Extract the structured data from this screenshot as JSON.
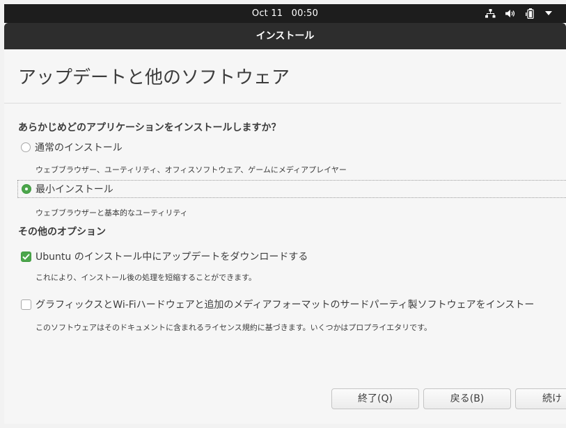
{
  "topbar": {
    "date": "Oct 11",
    "time": "00:50",
    "icons": [
      "network-icon",
      "volume-icon",
      "battery-icon",
      "chevron-down-icon"
    ]
  },
  "window": {
    "title": "インストール"
  },
  "page": {
    "title": "アップデートと他のソフトウェア"
  },
  "install_type": {
    "question": "あらかじめどのアプリケーションをインストールしますか？",
    "options": [
      {
        "label": "通常のインストール",
        "description": "ウェブブラウザー、ユーティリティ、オフィスソフトウェア、ゲームにメディアプレイヤー",
        "selected": false
      },
      {
        "label": "最小インストール",
        "description": "ウェブブラウザーと基本的なユーティリティ",
        "selected": true
      }
    ]
  },
  "other_options": {
    "heading": "その他のオプション",
    "items": [
      {
        "label": "Ubuntu のインストール中にアップデートをダウンロードする",
        "description": "これにより、インストール後の処理を短縮することができます。",
        "checked": true
      },
      {
        "label": "グラフィックスとWi-Fiハードウェアと追加のメディアフォーマットのサードパーティ製ソフトウェアをインストー",
        "description": "このソフトウェアはそのドキュメントに含まれるライセンス規約に基づきます。いくつかはプロプライエタリです。",
        "checked": false
      }
    ]
  },
  "buttons": {
    "quit": "終了(Q)",
    "back": "戻る(B)",
    "next": "続け"
  },
  "colors": {
    "topbar_bg": "#1d1d1d",
    "titlebar_bg": "#2d2d2d",
    "accent_green": "#4ca64c",
    "window_bg": "#f6f6f6"
  }
}
